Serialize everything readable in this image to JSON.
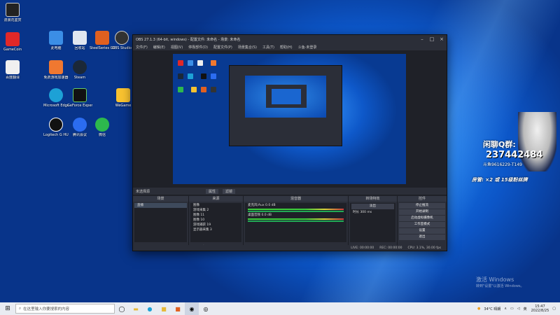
{
  "desktop": {
    "icons": [
      {
        "label": "流浪花鉴赏",
        "color": "#222"
      },
      {
        "label": "GameCoin",
        "color": "#e02828"
      },
      {
        "label": "百度翻译",
        "color": "#f0f0f0"
      },
      {
        "label": "此电脑",
        "color": "#3b8ee6"
      },
      {
        "label": "回收站",
        "color": "#e0e6f0"
      },
      {
        "label": "免费游戏加速器",
        "color": "#f07830"
      },
      {
        "label": "Microsoft Edge",
        "color": "#1da1d6"
      },
      {
        "label": "GeForce Experience",
        "color": "#fff"
      },
      {
        "label": "Logitech G HUB",
        "color": "#111"
      },
      {
        "label": "腾讯会议",
        "color": "#2b6cf0"
      },
      {
        "label": "Steam",
        "color": "#1b2838"
      },
      {
        "label": "OBS Studio",
        "color": "#333"
      },
      {
        "label": "SteelSeries GG",
        "color": "#e06020"
      },
      {
        "label": "微信",
        "color": "#2db84d"
      },
      {
        "label": "WeGame",
        "color": "#f8c230"
      }
    ]
  },
  "obs": {
    "title": "OBS 27.1.3 (64-bit, windows) - 配置文件: 未命名 - 场景: 未命名",
    "menu": [
      "文件(F)",
      "编辑(E)",
      "视图(V)",
      "停靠部件(D)",
      "配置文件(P)",
      "场景集合(S)",
      "工具(T)",
      "帮助(H)",
      "斗鱼-未登录"
    ],
    "scene_label": "未选择源",
    "tabs": [
      "属性",
      "滤镜"
    ],
    "docks": {
      "scenes": {
        "title": "场景",
        "items": [
          "直播"
        ]
      },
      "sources": {
        "title": "来源",
        "items": [
          "图像",
          "游戏采集 2",
          "图像 11",
          "图像 10",
          "游戏捕获 19",
          "显示器采集 3"
        ]
      },
      "mixer": {
        "title": "混音器",
        "channels": [
          {
            "name": "桌面音频",
            "level": "0.0 dB"
          },
          {
            "name": "麦克风/Aux",
            "level": "0.0 dB"
          }
        ]
      },
      "transitions": {
        "title": "转场特效",
        "type": "淡出",
        "duration_label": "时长",
        "duration": "300 ms"
      },
      "controls": {
        "title": "控件",
        "buttons": [
          "停止推流",
          "开始录制",
          "启动虚拟摄像机",
          "工作室模式",
          "设置",
          "退出"
        ]
      }
    },
    "status": {
      "live": "LIVE: 00:00:00",
      "rec": "REC: 00:00:00",
      "cpu": "CPU: 3.1%, 30.00 fps"
    }
  },
  "overlay": {
    "qq_label": "闲聊Q群:",
    "qq_number": "237442484",
    "douyu": "斗鱼9616229-T149",
    "room": "房管: ×2 或 15级粉丝牌"
  },
  "watermark": {
    "line1": "激活 Windows",
    "line2": "转到\"设置\"以激活 Windows。"
  },
  "taskbar": {
    "search_placeholder": "在这里输入你要搜索的内容",
    "weather": "34°C 晴朗",
    "ime": "英",
    "time": "15:47",
    "date": "2022/8/25"
  }
}
